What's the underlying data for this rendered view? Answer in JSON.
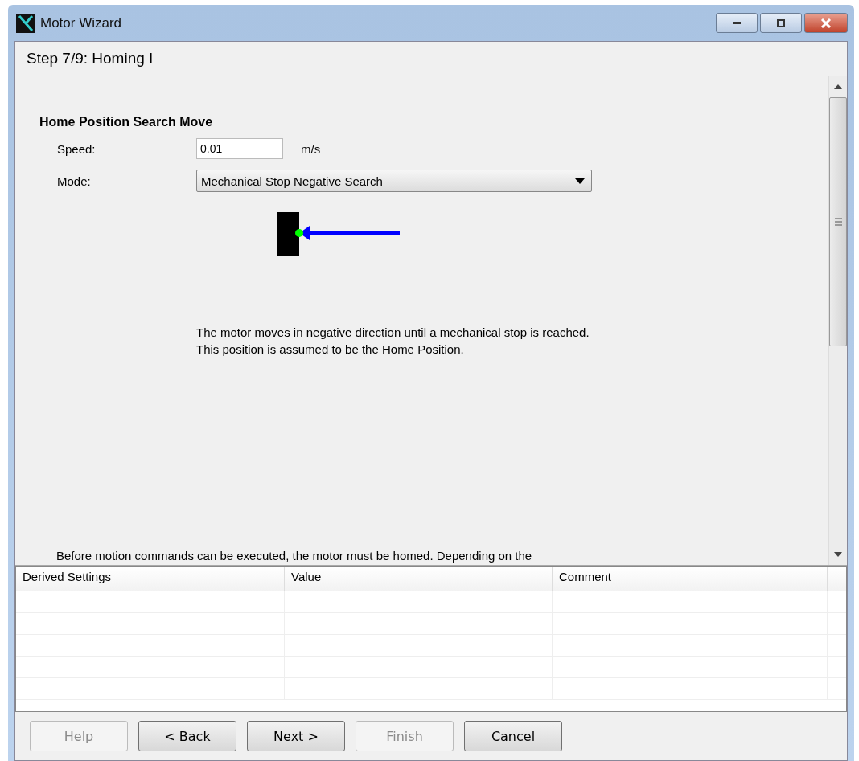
{
  "window": {
    "title": "Motor Wizard"
  },
  "step_title": "Step 7/9: Homing I",
  "section": {
    "heading": "Home Position Search Move",
    "fields": [
      {
        "kind": "text",
        "label": "Speed:",
        "value": "0.01",
        "unit": "m/s"
      },
      {
        "kind": "dropdown",
        "label": "Mode:",
        "value": "Mechanical Stop Negative Search"
      }
    ],
    "description": "The motor moves in negative direction until a mechanical stop is reached. This position is assumed to be the Home Position.",
    "footer_text": "Before motion commands can be executed, the motor must be homed. Depending on the"
  },
  "table": {
    "columns": [
      "Derived Settings",
      "Value",
      "Comment"
    ]
  },
  "buttons": [
    {
      "label": "Help",
      "disabled": true
    },
    {
      "label": "< Back",
      "disabled": false
    },
    {
      "label": "Next >",
      "disabled": false
    },
    {
      "label": "Finish",
      "disabled": true
    },
    {
      "label": "Cancel",
      "disabled": false
    }
  ]
}
